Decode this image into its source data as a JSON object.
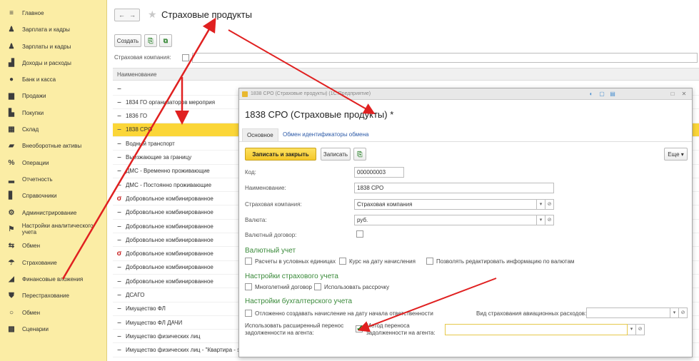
{
  "sidebar": {
    "items": [
      {
        "label": "Главное",
        "icon": "menu-icon",
        "glyph": "≡"
      },
      {
        "label": "Зарплата и кадры",
        "icon": "person-icon",
        "glyph": "♟"
      },
      {
        "label": "Зарплаты и кадры",
        "icon": "person-icon",
        "glyph": "♟"
      },
      {
        "label": "Доходы и расходы",
        "icon": "chart-icon",
        "glyph": "▟"
      },
      {
        "label": "Банк и касса",
        "icon": "coin-icon",
        "glyph": "●"
      },
      {
        "label": "Продажи",
        "icon": "briefcase-icon",
        "glyph": "▆"
      },
      {
        "label": "Покупки",
        "icon": "cart-icon",
        "glyph": "▙"
      },
      {
        "label": "Склад",
        "icon": "warehouse-icon",
        "glyph": "▦"
      },
      {
        "label": "Внеоборотные активы",
        "icon": "truck-icon",
        "glyph": "▰"
      },
      {
        "label": "Операции",
        "icon": "percent-icon",
        "glyph": "%"
      },
      {
        "label": "Отчетность",
        "icon": "bar-chart-icon",
        "glyph": "▂"
      },
      {
        "label": "Справочники",
        "icon": "book-icon",
        "glyph": "▋"
      },
      {
        "label": "Администрирование",
        "icon": "gear-icon",
        "glyph": "⚙"
      },
      {
        "label": "Настройки аналитического учета",
        "icon": "settings-icon",
        "glyph": "⚑"
      },
      {
        "label": "Обмен",
        "icon": "exchange-icon",
        "glyph": "⇆"
      },
      {
        "label": "Страхование",
        "icon": "umbrella-icon",
        "glyph": "☂"
      },
      {
        "label": "Финансовые вложения",
        "icon": "investment-icon",
        "glyph": "◢"
      },
      {
        "label": "Перестрахование",
        "icon": "shield-icon",
        "glyph": "⛊"
      },
      {
        "label": "Обмен",
        "icon": "circle-icon",
        "glyph": "○"
      },
      {
        "label": "Сценарии",
        "icon": "scenario-icon",
        "glyph": "▩"
      }
    ]
  },
  "header": {
    "back": "←",
    "forward": "→",
    "star": "★",
    "title": "Страховые продукты"
  },
  "toolbar": {
    "create_label": "Создать",
    "filter_label": "Страховая компания:"
  },
  "list": {
    "header": "Наименование",
    "rows": [
      {
        "mark": "–",
        "text": ""
      },
      {
        "mark": "–",
        "text": "1834 ГО организаторов мероприя"
      },
      {
        "mark": "–",
        "text": "1836 ГО"
      },
      {
        "mark": "–",
        "text": "1838 СРО",
        "selected": true
      },
      {
        "mark": "–",
        "text": "Водный транспорт"
      },
      {
        "mark": "–",
        "text": "Выезжающие за границу"
      },
      {
        "mark": "–",
        "text": "ДМС - Временно проживающие"
      },
      {
        "mark": "–",
        "text": "ДМС - Постоянно проживающие"
      },
      {
        "mark": "σ",
        "text": "Добровольное комбинированное",
        "red": true
      },
      {
        "mark": "–",
        "text": "Добровольное комбинированное"
      },
      {
        "mark": "–",
        "text": "Добровольное комбинированное"
      },
      {
        "mark": "–",
        "text": "Добровольное комбинированное"
      },
      {
        "mark": "σ",
        "text": "Добровольное комбинированное",
        "red": true
      },
      {
        "mark": "–",
        "text": "Добровольное комбинированное"
      },
      {
        "mark": "–",
        "text": "Добровольное комбинированное"
      },
      {
        "mark": "–",
        "text": "ДСАГО"
      },
      {
        "mark": "–",
        "text": "Имущество ФЛ"
      },
      {
        "mark": "–",
        "text": "Имущество ФЛ ДАЧИ"
      },
      {
        "mark": "–",
        "text": "Имущество физических лиц"
      },
      {
        "mark": "–",
        "text": "Имущество физических лиц - \"Квартира - экспресс Плюс\""
      }
    ]
  },
  "dialog": {
    "window_title": "1838 СРО (Страховые продукты) (1С:Предприятие)",
    "title": "1838 СРО (Страховые продукты) *",
    "tab_main": "Основное",
    "tab_exchange": "Обмен идентификаторы обмена",
    "save_close": "Записать и закрыть",
    "save": "Записать",
    "more": "Еще ▾",
    "fields": {
      "code_label": "Код:",
      "code_value": "000000003",
      "name_label": "Наименование:",
      "name_value": "1838 СРО",
      "company_label": "Страховая компания:",
      "company_value": "Страховая компания",
      "currency_label": "Валюта:",
      "currency_value": "руб.",
      "currency_contract_label": "Валютный договор:"
    },
    "section_currency": "Валютный учет",
    "cb_conditional_units": "Расчеты в условных единицах",
    "cb_rate_date": "Курс на дату начисления",
    "cb_edit_currency": "Позволять редактировать информацию по валютам",
    "section_insurance": "Настройки страхового учета",
    "cb_long_term": "Многолетний договор",
    "cb_installment": "Использовать рассрочку",
    "section_accounting": "Настройки бухгалтерского учета",
    "cb_defer_accrual": "Отложенно создавать начисление на дату начала ответственности",
    "aviation_label": "Вид страхования авиационных расходов:",
    "extended_transfer_label_1": "Использовать расширенный перенос",
    "extended_transfer_label_2": "задолженности на агента:",
    "transfer_method_label_1": "Метод переноса",
    "transfer_method_label_2": "задолженности на агента:"
  },
  "colors": {
    "sidebar_bg": "#fbeda5",
    "selected_row": "#fbd638",
    "accent_green": "#3a8a3a",
    "arrow_red": "#e02020"
  }
}
